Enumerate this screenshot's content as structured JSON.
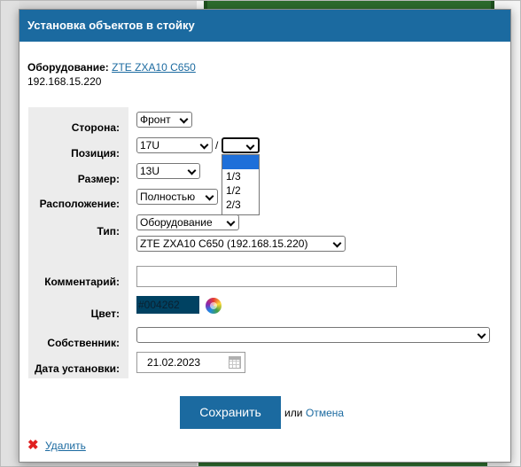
{
  "dialog": {
    "title": "Установка объектов в стойку"
  },
  "equipment": {
    "label": "Оборудование:",
    "link": "ZTE ZXA10 C650",
    "ip": "192.168.15.220"
  },
  "form": {
    "side": {
      "label": "Сторона:",
      "value": "Фронт"
    },
    "position": {
      "label": "Позиция:",
      "value": "17U",
      "separator": "/",
      "fraction_value": "",
      "fraction_options": [
        "",
        "1/3",
        "1/2",
        "2/3"
      ]
    },
    "size": {
      "label": "Размер:",
      "value": "13U"
    },
    "placement": {
      "label": "Расположение:",
      "value": "Полностью"
    },
    "type": {
      "label": "Тип:",
      "value": "Оборудование",
      "device_value": "ZTE ZXA10 C650 (192.168.15.220)"
    },
    "comment": {
      "label": "Комментарий:",
      "value": ""
    },
    "color": {
      "label": "Цвет:",
      "value": "#004262"
    },
    "owner": {
      "label": "Собственник:",
      "value": ""
    },
    "install_date": {
      "label": "Дата установки:",
      "value": "21.02.2023"
    }
  },
  "actions": {
    "save": "Сохранить",
    "or": "или",
    "cancel": "Отмена",
    "delete": "Удалить"
  },
  "colors": {
    "accent": "#1b6aa0",
    "delete_icon": "#e02020",
    "selected_option": "#1e6fd9"
  },
  "icons": {
    "color_picker": "color-wheel-icon",
    "calendar": "calendar-icon",
    "delete": "close-icon"
  }
}
